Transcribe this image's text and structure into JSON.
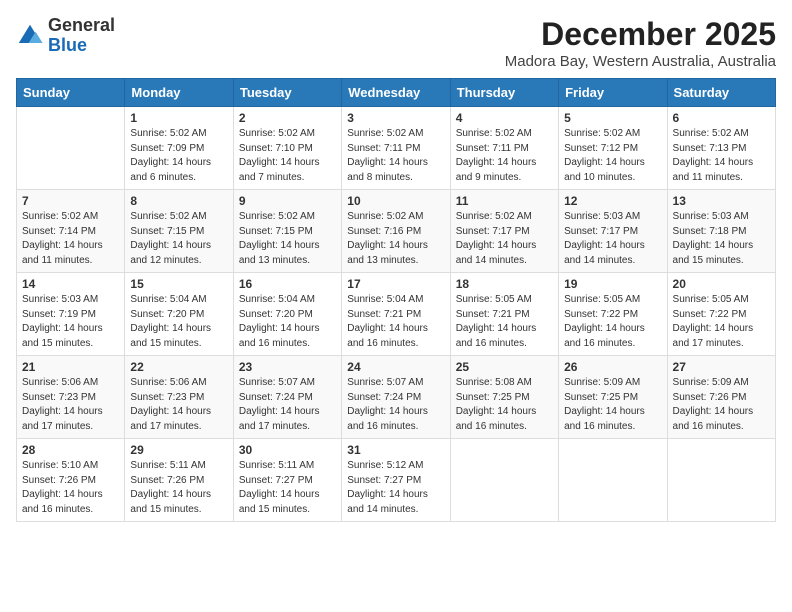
{
  "header": {
    "logo_general": "General",
    "logo_blue": "Blue",
    "month_title": "December 2025",
    "location": "Madora Bay, Western Australia, Australia"
  },
  "calendar": {
    "days_of_week": [
      "Sunday",
      "Monday",
      "Tuesday",
      "Wednesday",
      "Thursday",
      "Friday",
      "Saturday"
    ],
    "weeks": [
      [
        {
          "day": "",
          "info": ""
        },
        {
          "day": "1",
          "info": "Sunrise: 5:02 AM\nSunset: 7:09 PM\nDaylight: 14 hours\nand 6 minutes."
        },
        {
          "day": "2",
          "info": "Sunrise: 5:02 AM\nSunset: 7:10 PM\nDaylight: 14 hours\nand 7 minutes."
        },
        {
          "day": "3",
          "info": "Sunrise: 5:02 AM\nSunset: 7:11 PM\nDaylight: 14 hours\nand 8 minutes."
        },
        {
          "day": "4",
          "info": "Sunrise: 5:02 AM\nSunset: 7:11 PM\nDaylight: 14 hours\nand 9 minutes."
        },
        {
          "day": "5",
          "info": "Sunrise: 5:02 AM\nSunset: 7:12 PM\nDaylight: 14 hours\nand 10 minutes."
        },
        {
          "day": "6",
          "info": "Sunrise: 5:02 AM\nSunset: 7:13 PM\nDaylight: 14 hours\nand 11 minutes."
        }
      ],
      [
        {
          "day": "7",
          "info": "Sunrise: 5:02 AM\nSunset: 7:14 PM\nDaylight: 14 hours\nand 11 minutes."
        },
        {
          "day": "8",
          "info": "Sunrise: 5:02 AM\nSunset: 7:15 PM\nDaylight: 14 hours\nand 12 minutes."
        },
        {
          "day": "9",
          "info": "Sunrise: 5:02 AM\nSunset: 7:15 PM\nDaylight: 14 hours\nand 13 minutes."
        },
        {
          "day": "10",
          "info": "Sunrise: 5:02 AM\nSunset: 7:16 PM\nDaylight: 14 hours\nand 13 minutes."
        },
        {
          "day": "11",
          "info": "Sunrise: 5:02 AM\nSunset: 7:17 PM\nDaylight: 14 hours\nand 14 minutes."
        },
        {
          "day": "12",
          "info": "Sunrise: 5:03 AM\nSunset: 7:17 PM\nDaylight: 14 hours\nand 14 minutes."
        },
        {
          "day": "13",
          "info": "Sunrise: 5:03 AM\nSunset: 7:18 PM\nDaylight: 14 hours\nand 15 minutes."
        }
      ],
      [
        {
          "day": "14",
          "info": "Sunrise: 5:03 AM\nSunset: 7:19 PM\nDaylight: 14 hours\nand 15 minutes."
        },
        {
          "day": "15",
          "info": "Sunrise: 5:04 AM\nSunset: 7:20 PM\nDaylight: 14 hours\nand 15 minutes."
        },
        {
          "day": "16",
          "info": "Sunrise: 5:04 AM\nSunset: 7:20 PM\nDaylight: 14 hours\nand 16 minutes."
        },
        {
          "day": "17",
          "info": "Sunrise: 5:04 AM\nSunset: 7:21 PM\nDaylight: 14 hours\nand 16 minutes."
        },
        {
          "day": "18",
          "info": "Sunrise: 5:05 AM\nSunset: 7:21 PM\nDaylight: 14 hours\nand 16 minutes."
        },
        {
          "day": "19",
          "info": "Sunrise: 5:05 AM\nSunset: 7:22 PM\nDaylight: 14 hours\nand 16 minutes."
        },
        {
          "day": "20",
          "info": "Sunrise: 5:05 AM\nSunset: 7:22 PM\nDaylight: 14 hours\nand 17 minutes."
        }
      ],
      [
        {
          "day": "21",
          "info": "Sunrise: 5:06 AM\nSunset: 7:23 PM\nDaylight: 14 hours\nand 17 minutes."
        },
        {
          "day": "22",
          "info": "Sunrise: 5:06 AM\nSunset: 7:23 PM\nDaylight: 14 hours\nand 17 minutes."
        },
        {
          "day": "23",
          "info": "Sunrise: 5:07 AM\nSunset: 7:24 PM\nDaylight: 14 hours\nand 17 minutes."
        },
        {
          "day": "24",
          "info": "Sunrise: 5:07 AM\nSunset: 7:24 PM\nDaylight: 14 hours\nand 16 minutes."
        },
        {
          "day": "25",
          "info": "Sunrise: 5:08 AM\nSunset: 7:25 PM\nDaylight: 14 hours\nand 16 minutes."
        },
        {
          "day": "26",
          "info": "Sunrise: 5:09 AM\nSunset: 7:25 PM\nDaylight: 14 hours\nand 16 minutes."
        },
        {
          "day": "27",
          "info": "Sunrise: 5:09 AM\nSunset: 7:26 PM\nDaylight: 14 hours\nand 16 minutes."
        }
      ],
      [
        {
          "day": "28",
          "info": "Sunrise: 5:10 AM\nSunset: 7:26 PM\nDaylight: 14 hours\nand 16 minutes."
        },
        {
          "day": "29",
          "info": "Sunrise: 5:11 AM\nSunset: 7:26 PM\nDaylight: 14 hours\nand 15 minutes."
        },
        {
          "day": "30",
          "info": "Sunrise: 5:11 AM\nSunset: 7:27 PM\nDaylight: 14 hours\nand 15 minutes."
        },
        {
          "day": "31",
          "info": "Sunrise: 5:12 AM\nSunset: 7:27 PM\nDaylight: 14 hours\nand 14 minutes."
        },
        {
          "day": "",
          "info": ""
        },
        {
          "day": "",
          "info": ""
        },
        {
          "day": "",
          "info": ""
        }
      ]
    ]
  }
}
